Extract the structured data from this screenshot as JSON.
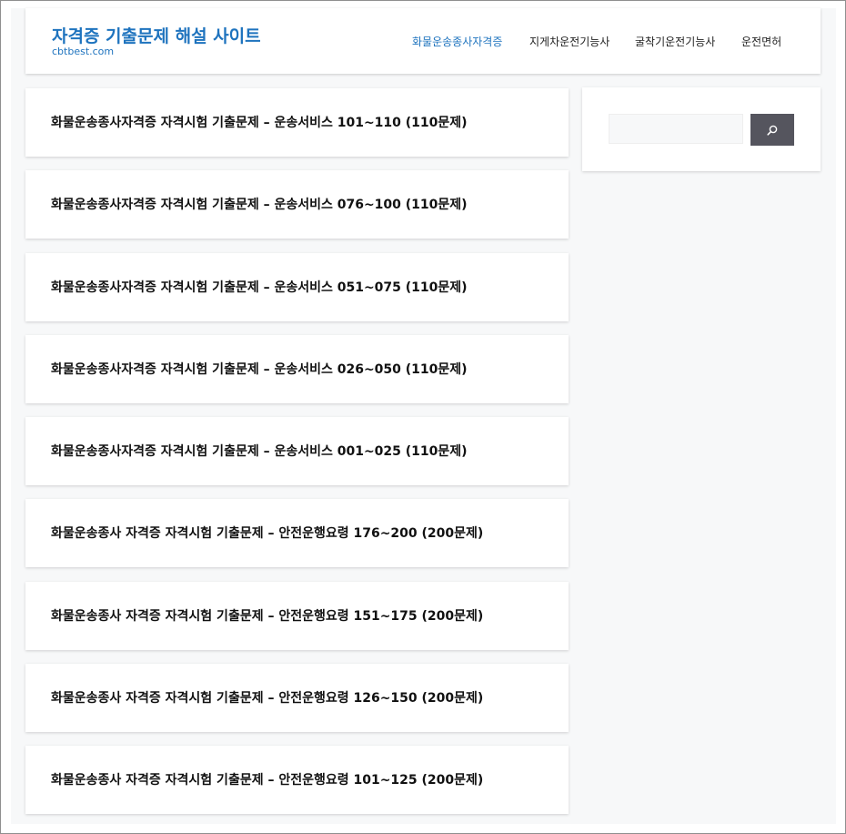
{
  "site": {
    "title": "자격증 기출문제 해설 사이트",
    "url": "cbtbest.com"
  },
  "nav": {
    "items": [
      {
        "label": "화물운송종사자격증",
        "active": true
      },
      {
        "label": "지게차운전기능사",
        "active": false
      },
      {
        "label": "굴착기운전기능사",
        "active": false
      },
      {
        "label": "운전면허",
        "active": false
      }
    ]
  },
  "posts": [
    {
      "title": "화물운송종사자격증 자격시험 기출문제 – 운송서비스 101~110 (110문제)"
    },
    {
      "title": "화물운송종사자격증 자격시험 기출문제 – 운송서비스 076~100 (110문제)"
    },
    {
      "title": "화물운송종사자격증 자격시험 기출문제 – 운송서비스 051~075 (110문제)"
    },
    {
      "title": "화물운송종사자격증 자격시험 기출문제 – 운송서비스 026~050 (110문제)"
    },
    {
      "title": "화물운송종사자격증 자격시험 기출문제 – 운송서비스 001~025 (110문제)"
    },
    {
      "title": "화물운송종사 자격증 자격시험 기출문제 – 안전운행요령 176~200 (200문제)"
    },
    {
      "title": "화물운송종사 자격증 자격시험 기출문제 – 안전운행요령 151~175 (200문제)"
    },
    {
      "title": "화물운송종사 자격증 자격시험 기출문제 – 안전운행요령 126~150 (200문제)"
    },
    {
      "title": "화물운송종사 자격증 자격시험 기출문제 – 안전운행요령 101~125 (200문제)"
    }
  ],
  "search": {
    "placeholder": "",
    "value": "",
    "icon": "search-icon"
  },
  "colors": {
    "accent": "#1e73be",
    "search_button": "#55555e",
    "page_background": "#f7f8f9"
  }
}
